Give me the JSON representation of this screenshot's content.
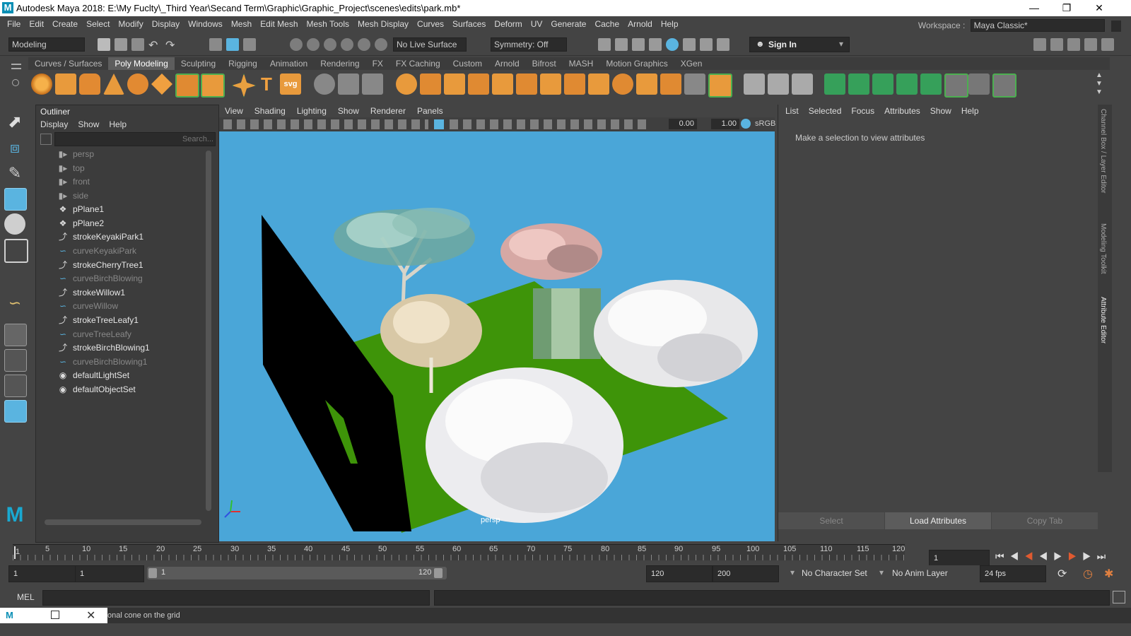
{
  "window": {
    "title": "Autodesk Maya 2018: E:\\My Fuclty\\_Third Year\\Secand Term\\Graphic\\Graphic_Project\\scenes\\edits\\park.mb*",
    "logo_letter": "M"
  },
  "menubar": {
    "items": [
      "File",
      "Edit",
      "Create",
      "Select",
      "Modify",
      "Display",
      "Windows",
      "Mesh",
      "Edit Mesh",
      "Mesh Tools",
      "Mesh Display",
      "Curves",
      "Surfaces",
      "Deform",
      "UV",
      "Generate",
      "Cache",
      "Arnold",
      "Help"
    ],
    "workspace_label": "Workspace :",
    "workspace_value": "Maya Classic*"
  },
  "statusline": {
    "mode": "Modeling",
    "live_surface": "No Live Surface",
    "symmetry": "Symmetry: Off",
    "sign_in": "Sign In"
  },
  "shelf": {
    "tabs": [
      "Curves / Surfaces",
      "Poly Modeling",
      "Sculpting",
      "Rigging",
      "Animation",
      "Rendering",
      "FX",
      "FX Caching",
      "Custom",
      "Arnold",
      "Bifrost",
      "MASH",
      "Motion Graphics",
      "XGen"
    ],
    "active_tab": "Poly Modeling",
    "svg_label": "svg"
  },
  "outliner": {
    "title": "Outliner",
    "menu": [
      "Display",
      "Show",
      "Help"
    ],
    "search_placeholder": "Search...",
    "items": [
      {
        "label": "persp",
        "icon": "camera-icon",
        "dim": true
      },
      {
        "label": "top",
        "icon": "camera-icon",
        "dim": true
      },
      {
        "label": "front",
        "icon": "camera-icon",
        "dim": true
      },
      {
        "label": "side",
        "icon": "camera-icon",
        "dim": true
      },
      {
        "label": "pPlane1",
        "icon": "mesh-icon",
        "dim": false
      },
      {
        "label": "pPlane2",
        "icon": "mesh-icon",
        "dim": false
      },
      {
        "label": "strokeKeyakiPark1",
        "icon": "stroke-icon",
        "dim": false
      },
      {
        "label": "curveKeyakiPark",
        "icon": "curve-icon",
        "dim": true
      },
      {
        "label": "strokeCherryTree1",
        "icon": "stroke-icon",
        "dim": false
      },
      {
        "label": "curveBirchBlowing",
        "icon": "curve-icon",
        "dim": true
      },
      {
        "label": "strokeWillow1",
        "icon": "stroke-icon",
        "dim": false
      },
      {
        "label": "curveWillow",
        "icon": "curve-icon",
        "dim": true
      },
      {
        "label": "strokeTreeLeafy1",
        "icon": "stroke-icon",
        "dim": false
      },
      {
        "label": "curveTreeLeafy",
        "icon": "curve-icon",
        "dim": true
      },
      {
        "label": "strokeBirchBlowing1",
        "icon": "stroke-icon",
        "dim": false
      },
      {
        "label": "curveBirchBlowing1",
        "icon": "curve-icon",
        "dim": true
      },
      {
        "label": "defaultLightSet",
        "icon": "set-icon",
        "dim": false
      },
      {
        "label": "defaultObjectSet",
        "icon": "set-icon",
        "dim": false
      }
    ]
  },
  "viewport": {
    "menu": [
      "View",
      "Shading",
      "Lighting",
      "Show",
      "Renderer",
      "Panels"
    ],
    "field_a": "0.00",
    "field_b": "1.00",
    "colorspace": "sRGB",
    "camera_label": "persp"
  },
  "attribute_editor": {
    "menu": [
      "List",
      "Selected",
      "Focus",
      "Attributes",
      "Show",
      "Help"
    ],
    "message": "Make a selection to view attributes",
    "buttons": [
      "Select",
      "Load Attributes",
      "Copy Tab"
    ]
  },
  "side_tabs": [
    "Channel Box / Layer Editor",
    "Modeling Toolkit",
    "Attribute Editor"
  ],
  "timeline": {
    "ticks": [
      "5",
      "10",
      "15",
      "20",
      "25",
      "30",
      "35",
      "40",
      "45",
      "50",
      "55",
      "60",
      "65",
      "70",
      "75",
      "80",
      "85",
      "90",
      "95",
      "100",
      "105",
      "110",
      "115",
      "120"
    ],
    "start_label": "1",
    "current_frame": "1"
  },
  "range": {
    "start": "1",
    "playback_start": "1",
    "slider_start": "1",
    "slider_end": "120",
    "playback_end": "120",
    "end": "200",
    "character_set": "No Character Set",
    "anim_layer": "No Anim Layer",
    "fps": "24 fps"
  },
  "commandline": {
    "label": "MEL",
    "help_text": "onal cone on the grid"
  },
  "colors": {
    "sky": "#4aa6d8",
    "grass": "#3e9409",
    "accent": "#5ab4e0"
  }
}
